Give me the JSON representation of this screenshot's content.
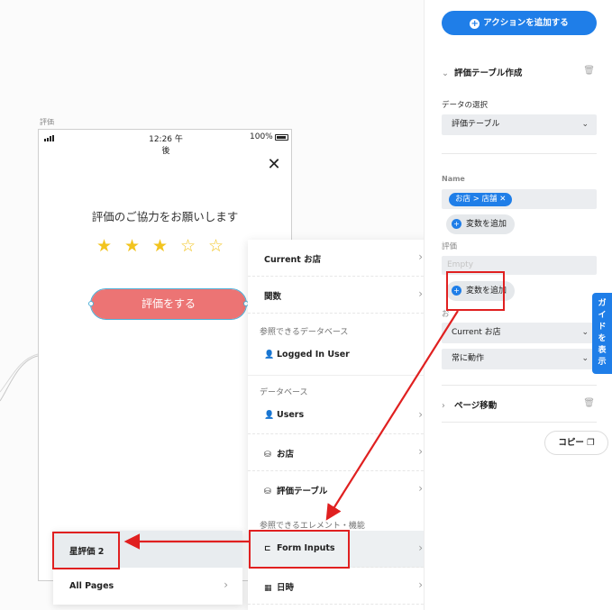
{
  "canvas": {
    "page_label": "評価",
    "phone": {
      "time": "12:26 午後",
      "battery": "100%",
      "close": "✕",
      "prompt": "評価のご協力をお願いします",
      "stars": [
        "★",
        "★",
        "★",
        "☆",
        "☆"
      ],
      "rating_filled": 3,
      "rating_max": 5,
      "rate_button": "評価をする"
    }
  },
  "dropdown": {
    "items": [
      {
        "label": "Current お店",
        "icon": ""
      },
      {
        "label": "関数",
        "icon": ""
      }
    ],
    "section_ref_db": "参照できるデータベース",
    "logged_in_user": "Logged In User",
    "section_db": "データベース",
    "db_items": [
      {
        "label": "Users",
        "icon": "user-icon"
      },
      {
        "label": "お店",
        "icon": "database-icon"
      },
      {
        "label": "評価テーブル",
        "icon": "database-icon"
      }
    ],
    "section_elements": "参照できるエレメント・機能",
    "form_inputs": "Form Inputs",
    "datetime": "日時"
  },
  "submenu": {
    "items": [
      {
        "label": "星評価 2"
      },
      {
        "label": "All Pages"
      }
    ]
  },
  "panel": {
    "add_action": "アクションを追加する",
    "section1_title": "評価テーブル作成",
    "data_select_label": "データの選択",
    "data_select_value": "評価テーブル",
    "name_label": "Name",
    "name_tag": "お店 > 店舗",
    "add_variable_1": "変数を追加",
    "rating_label": "評価",
    "rating_placeholder": "Empty",
    "add_variable_2": "変数を追加",
    "obscured_label": "お",
    "select_current_shop": "Current お店",
    "select_always": "常に動作",
    "section2_title": "ページ移動",
    "copy_button": "コピー",
    "guide_tab": "ガイドを表示"
  },
  "colors": {
    "accent": "#1f7ee8",
    "rate_button": "#ec7474",
    "star": "#f2c41f",
    "annotation_red": "#e02020"
  }
}
